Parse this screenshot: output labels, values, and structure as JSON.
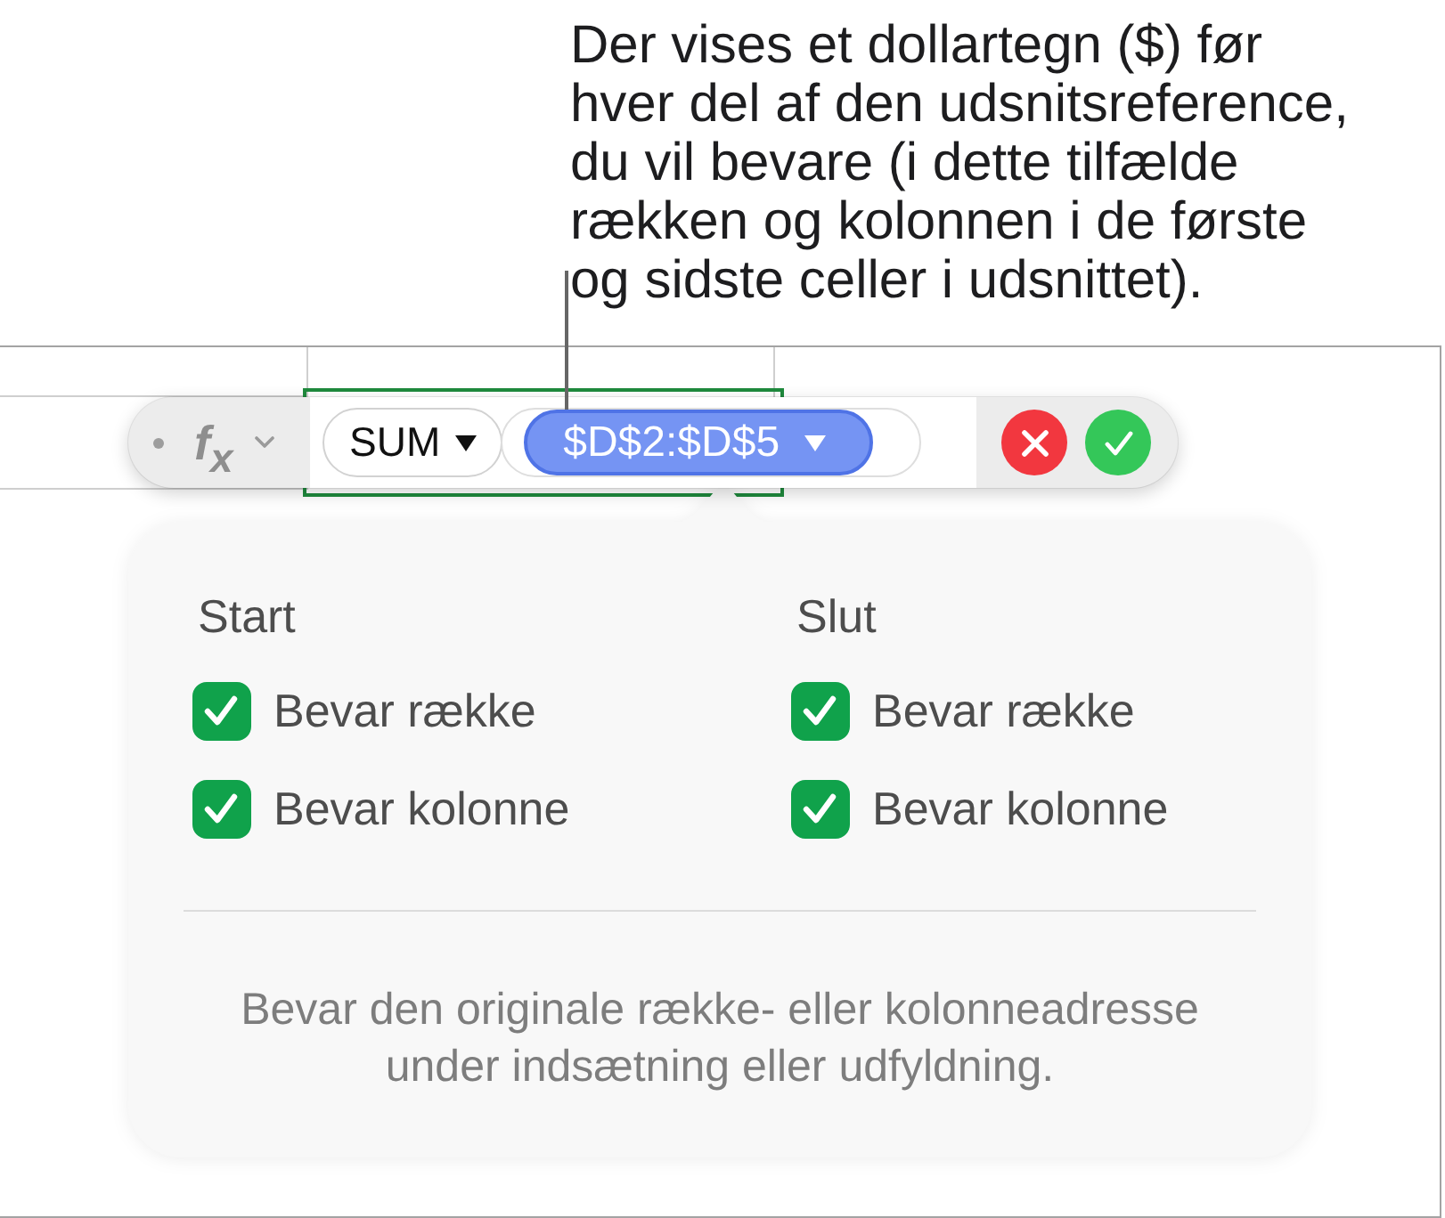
{
  "callout": {
    "text": "Der vises et dollartegn ($) før\nhver del af den udsnitsreference,\ndu vil bevare (i dette tilfælde\nrækken og kolonnen i de første\nog sidste celler i udsnittet)."
  },
  "formula_bar": {
    "function_label": "f$_{x}$",
    "tokens": [
      {
        "kind": "function",
        "label": "SUM",
        "selected": false
      },
      {
        "kind": "range",
        "label": "$D$2:$D$5",
        "selected": true
      }
    ]
  },
  "popover": {
    "columns": [
      {
        "title": "Start",
        "options": [
          {
            "label": "Bevar række",
            "checked": true
          },
          {
            "label": "Bevar kolonne",
            "checked": true
          }
        ]
      },
      {
        "title": "Slut",
        "options": [
          {
            "label": "Bevar række",
            "checked": true
          },
          {
            "label": "Bevar kolonne",
            "checked": true
          }
        ]
      }
    ],
    "description": "Bevar den originale række- eller kolonneadresse\nunder indsætning eller udfyldning."
  }
}
